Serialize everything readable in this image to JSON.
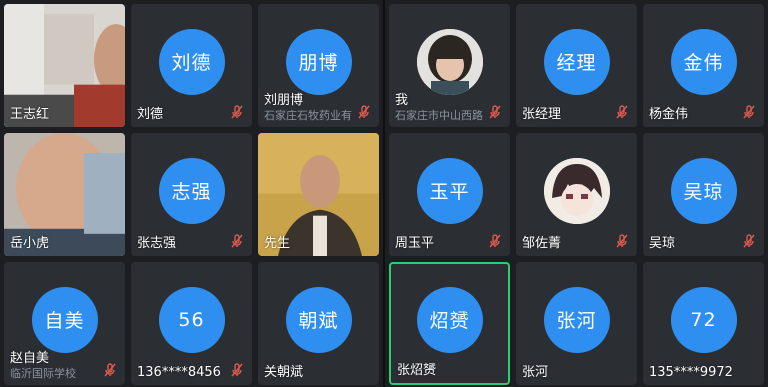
{
  "colors": {
    "avatar": "#2f8ff0",
    "tile": "#2b2f34",
    "active_border": "#2ecc71",
    "muted_mic": "#e05a4e"
  },
  "left_panel": [
    {
      "display": "王志红",
      "avatar_text": "",
      "video": true,
      "name": "王志红",
      "org": ""
    },
    {
      "avatar_text": "刘德",
      "name": "刘德",
      "org": "",
      "muted": true
    },
    {
      "avatar_text": "朋博",
      "name": "刘朋博",
      "org": "石家庄石牧药业有",
      "muted": true
    },
    {
      "avatar_text": "",
      "video": true,
      "name": "岳小虎",
      "org": ""
    },
    {
      "avatar_text": "志强",
      "name": "张志强",
      "org": "",
      "muted": true
    },
    {
      "avatar_text": "",
      "video": true,
      "name": "先生",
      "org": ""
    },
    {
      "avatar_text": "自美",
      "name": "赵自美",
      "org": "临沂国际学校",
      "muted": true
    },
    {
      "avatar_text": "56",
      "name": "136****8456",
      "org": "",
      "muted": true
    },
    {
      "avatar_text": "朝斌",
      "name": "关朝斌",
      "org": "",
      "muted": false
    }
  ],
  "right_panel": [
    {
      "avatar_text": "",
      "photo": "girl-photo",
      "name": "我",
      "org": "石家庄市中山西路",
      "muted": true
    },
    {
      "avatar_text": "经理",
      "name": "张经理",
      "org": "",
      "muted": true
    },
    {
      "avatar_text": "金伟",
      "name": "杨金伟",
      "org": "",
      "muted": true
    },
    {
      "avatar_text": "玉平",
      "name": "周玉平",
      "org": "",
      "muted": true
    },
    {
      "avatar_text": "",
      "photo": "anime-photo",
      "name": "邹佐菁",
      "org": "",
      "muted": true
    },
    {
      "avatar_text": "吴琼",
      "name": "吴琼",
      "org": "",
      "muted": true
    },
    {
      "avatar_text": "炤赟",
      "name": "张炤赟",
      "org": "",
      "muted": false,
      "active": true
    },
    {
      "avatar_text": "张河",
      "name": "张河",
      "org": "",
      "muted": false
    },
    {
      "avatar_text": "72",
      "name": "135****9972",
      "org": "",
      "muted": false
    }
  ]
}
